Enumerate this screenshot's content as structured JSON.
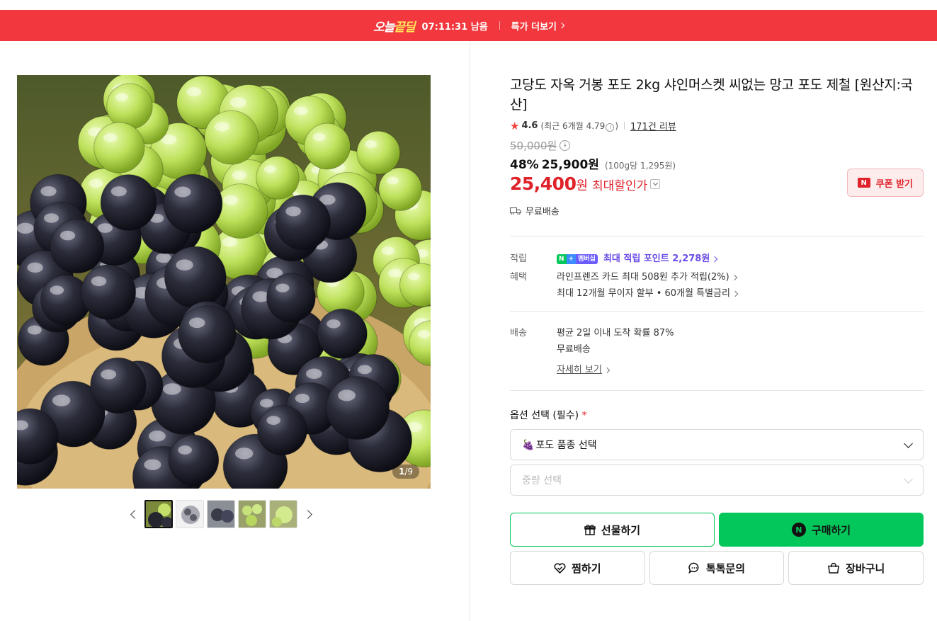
{
  "banner": {
    "brand_a": "오늘",
    "brand_b": "끝딜",
    "timer": "07:11:31 남음",
    "more_label": "특가 더보기",
    "color": "#f2383e"
  },
  "gallery": {
    "counter_current": "1",
    "counter_total": "/9",
    "thumb_count": 5
  },
  "product": {
    "title": "고당도 자옥 거봉 포도 2kg 샤인머스켓 씨없는 망고 포도 제철 [원산지:국산]",
    "rating": "4.6",
    "recent_rating": "(최근 6개월 4.79",
    "recent_close": ")",
    "reviews": "171건 리뷰",
    "original_price": "50,000원",
    "discount_pct": "48%",
    "sale_price": "25,900원",
    "unit_price": "(100g당 1,295원)",
    "best_price": "25,400",
    "best_won": "원",
    "best_label": "최대할인가",
    "coupon_label": "쿠폰 받기",
    "shipping_free": "무료배송"
  },
  "benefits": {
    "points_key": "적립",
    "badge_n": "N",
    "badge_plus": "+",
    "badge_member": "멤버십",
    "points_text": "최대 적립 포인트 2,278원",
    "benefit_key": "혜택",
    "benefit_1": "라인프렌즈 카드 최대 508원 추가 적립(2%)",
    "benefit_2": "최대 12개월 무이자 할부 • 60개월 특별금리"
  },
  "delivery": {
    "key": "배송",
    "line_1": "평균 2일 이내 도착 확률 87%",
    "line_2": "무료배송",
    "more": "자세히 보기"
  },
  "options": {
    "title": "옵션 선택 (필수)",
    "required_mark": "*",
    "select_1": "포도 품종 선택",
    "select_2": "중량 선택"
  },
  "actions": {
    "gift": "선물하기",
    "buy": "구매하기",
    "wish": "찜하기",
    "talk": "톡톡문의",
    "cart": "장바구니",
    "accent": "#03c75a"
  }
}
